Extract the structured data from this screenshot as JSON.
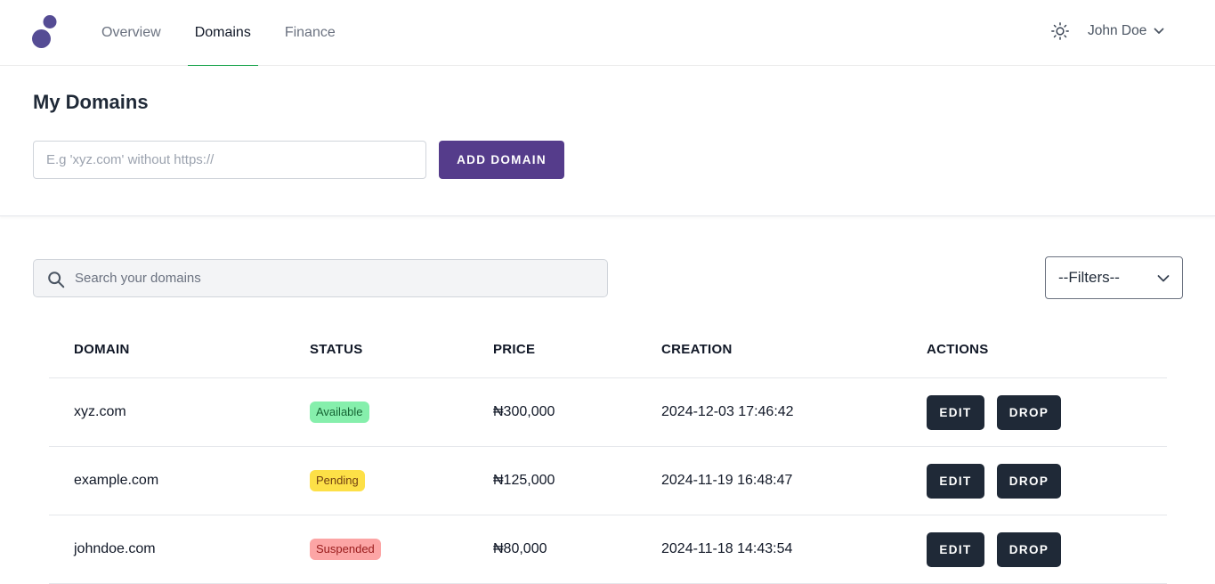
{
  "header": {
    "nav": [
      {
        "label": "Overview",
        "active": false
      },
      {
        "label": "Domains",
        "active": true
      },
      {
        "label": "Finance",
        "active": false
      }
    ],
    "user_name": "John Doe",
    "icons": {
      "logo": "logo-icon",
      "theme": "sun-icon",
      "user_menu": "chevron-down-icon"
    },
    "colors": {
      "logo": "#554c94",
      "active_tab_underline": "#16a34a"
    }
  },
  "add_domain": {
    "title": "My Domains",
    "input_placeholder": "E.g 'xyz.com' without https://",
    "input_value": "",
    "button_label": "ADD DOMAIN",
    "button_color": "#553c8b"
  },
  "search": {
    "placeholder": "Search your domains",
    "value": "",
    "icon": "search-icon"
  },
  "filters": {
    "selected": "--Filters--",
    "icon": "chevron-down-icon"
  },
  "table": {
    "columns": [
      "DOMAIN",
      "STATUS",
      "PRICE",
      "CREATION",
      "ACTIONS"
    ],
    "rows": [
      {
        "domain": "xyz.com",
        "status": "Available",
        "price": "₦300,000",
        "creation": "2024-12-03 17:46:42",
        "edit_label": "EDIT",
        "drop_label": "DROP"
      },
      {
        "domain": "example.com",
        "status": "Pending",
        "price": "₦125,000",
        "creation": "2024-11-19 16:48:47",
        "edit_label": "EDIT",
        "drop_label": "DROP"
      },
      {
        "domain": "johndoe.com",
        "status": "Suspended",
        "price": "₦80,000",
        "creation": "2024-11-18 14:43:54",
        "edit_label": "EDIT",
        "drop_label": "DROP"
      }
    ],
    "status_colors": {
      "Available": "#86efac",
      "Pending": "#fde047",
      "Suspended": "#fca5a5"
    }
  }
}
